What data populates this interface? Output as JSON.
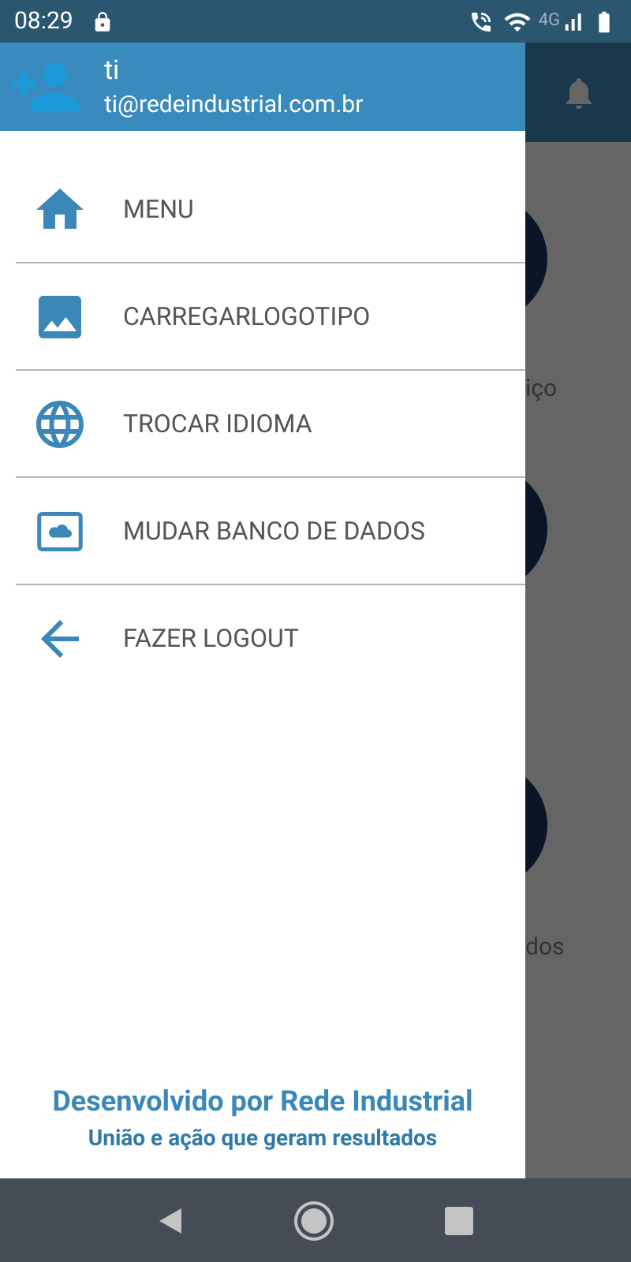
{
  "status_bar": {
    "time": "08:29",
    "network_label": "4G"
  },
  "drawer": {
    "user": {
      "name": "ti",
      "email": "ti@redeindustrial.com.br"
    },
    "items": [
      {
        "label": "MENU",
        "kind": "home"
      },
      {
        "label": "CARREGARLOGOTIPO",
        "kind": "image"
      },
      {
        "label": "TROCAR IDIOMA",
        "kind": "globe"
      },
      {
        "label": "MUDAR BANCO DE DADOS",
        "kind": "cloud"
      },
      {
        "label": "FAZER LOGOUT",
        "kind": "back"
      }
    ],
    "footer": {
      "title": "Desenvolvido por Rede Industrial",
      "subtitle": "União e ação que geram resultados"
    }
  },
  "background": {
    "labels": [
      "iço",
      "dos"
    ]
  }
}
